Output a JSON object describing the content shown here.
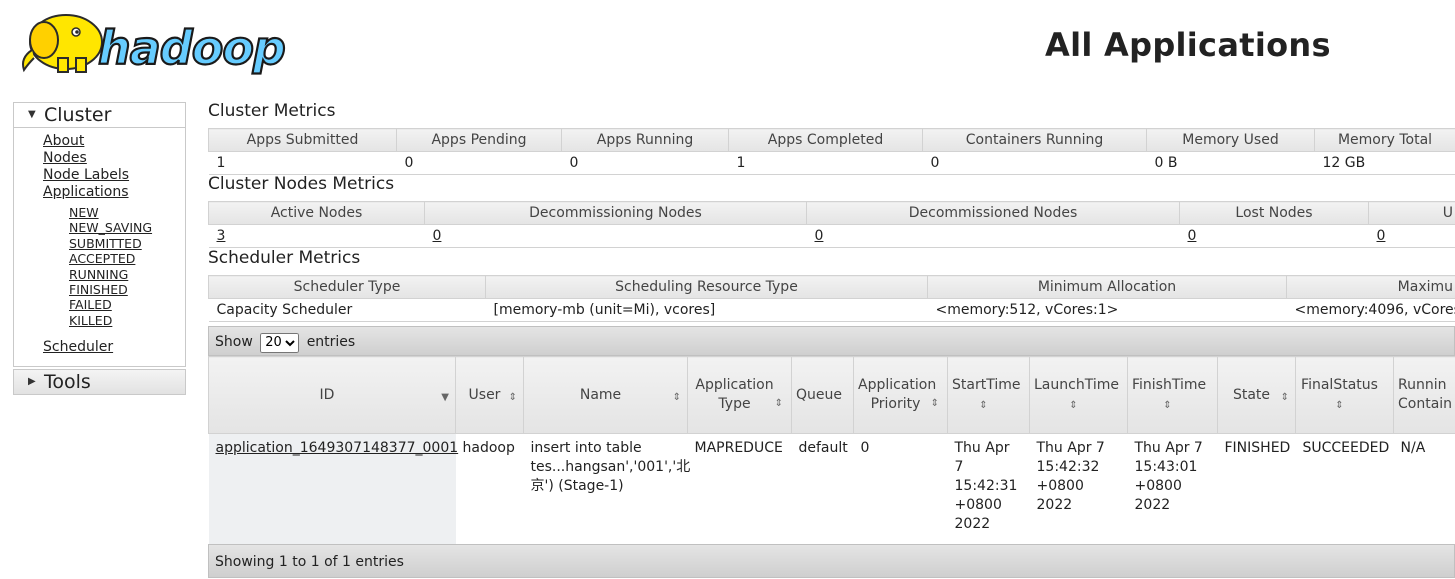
{
  "header": {
    "title": "All Applications",
    "logo_text": "hadoop"
  },
  "sidebar": {
    "cluster_label": "Cluster",
    "links": [
      "About",
      "Nodes",
      "Node Labels",
      "Applications"
    ],
    "app_states": [
      "NEW",
      "NEW_SAVING",
      "SUBMITTED",
      "ACCEPTED",
      "RUNNING",
      "FINISHED",
      "FAILED",
      "KILLED"
    ],
    "scheduler_label": "Scheduler",
    "tools_label": "Tools"
  },
  "cluster_metrics": {
    "title": "Cluster Metrics",
    "headers": [
      "Apps Submitted",
      "Apps Pending",
      "Apps Running",
      "Apps Completed",
      "Containers Running",
      "Memory Used",
      "Memory Total"
    ],
    "values": [
      "1",
      "0",
      "0",
      "1",
      "0",
      "0 B",
      "12 GB"
    ]
  },
  "nodes_metrics": {
    "title": "Cluster Nodes Metrics",
    "headers": [
      "Active Nodes",
      "Decommissioning Nodes",
      "Decommissioned Nodes",
      "Lost Nodes",
      "U"
    ],
    "values": [
      "3",
      "0",
      "0",
      "0",
      "0"
    ]
  },
  "scheduler_metrics": {
    "title": "Scheduler Metrics",
    "headers": [
      "Scheduler Type",
      "Scheduling Resource Type",
      "Minimum Allocation",
      "Maximu"
    ],
    "values": [
      "Capacity Scheduler",
      "[memory-mb (unit=Mi), vcores]",
      "<memory:512, vCores:1>",
      "<memory:4096, vCores"
    ]
  },
  "apps": {
    "show_label": "Show",
    "page_size": "20",
    "entries_label": "entries",
    "columns": {
      "id": "ID",
      "user": "User",
      "name": "Name",
      "app_type_1": "Application",
      "app_type_2": "Type",
      "queue": "Queue",
      "priority_1": "Application",
      "priority_2": "Priority",
      "start": "StartTime",
      "launch": "LaunchTime",
      "finish": "FinishTime",
      "state": "State",
      "final": "FinalStatus",
      "running_1": "Runnin",
      "running_2": "Contain"
    },
    "row": {
      "id": "application_1649307148377_0001",
      "user": "hadoop",
      "name": "insert into table tes...hangsan','001','北京') (Stage-1)",
      "app_type": "MAPREDUCE",
      "queue": "default",
      "priority": "0",
      "start": "Thu Apr 7 15:42:31 +0800 2022",
      "launch": "Thu Apr 7 15:42:32 +0800 2022",
      "finish": "Thu Apr 7 15:43:01 +0800 2022",
      "state": "FINISHED",
      "final": "SUCCEEDED",
      "running": "N/A"
    },
    "footer": "Showing 1 to 1 of 1 entries"
  },
  "colors": {
    "logo_yellow": "#ffe600",
    "logo_blue": "#66ccff",
    "header_bg": "#e4e4e4"
  }
}
